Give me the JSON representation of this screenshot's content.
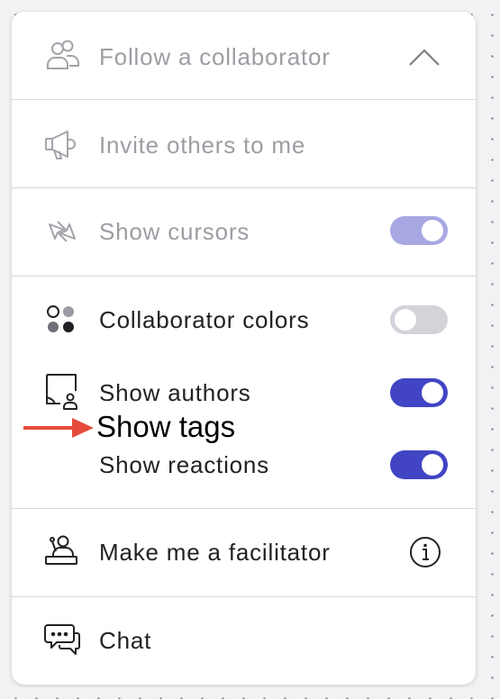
{
  "menu": {
    "follow_collaborator": {
      "label": "Follow a collaborator",
      "icon": "users-icon",
      "expanded": true
    },
    "invite_others": {
      "label": "Invite others to me",
      "icon": "megaphone-icon"
    },
    "show_cursors": {
      "label": "Show cursors",
      "icon": "cursors-icon",
      "toggle": "on",
      "enabled": false
    },
    "collaborator_colors": {
      "label": "Collaborator colors",
      "icon": "dots-palette-icon",
      "toggle": "off"
    },
    "show_authors": {
      "label": "Show authors",
      "icon": "sticky-note-user-icon",
      "toggle": "on"
    },
    "show_reactions": {
      "label": "Show reactions",
      "toggle": "on"
    },
    "make_facilitator": {
      "label": "Make me a facilitator",
      "icon": "facilitator-icon",
      "info_icon": "info-icon"
    },
    "chat": {
      "label": "Chat",
      "icon": "chat-bubbles-icon"
    }
  },
  "annotation": {
    "text": "Show tags",
    "arrow_color": "#e54b3c"
  },
  "colors": {
    "accent": "#4145c4",
    "accent_disabled": "#a7a8e3",
    "toggle_off": "#d2d4da",
    "text": "#222226",
    "text_disabled": "#9d9da4"
  }
}
